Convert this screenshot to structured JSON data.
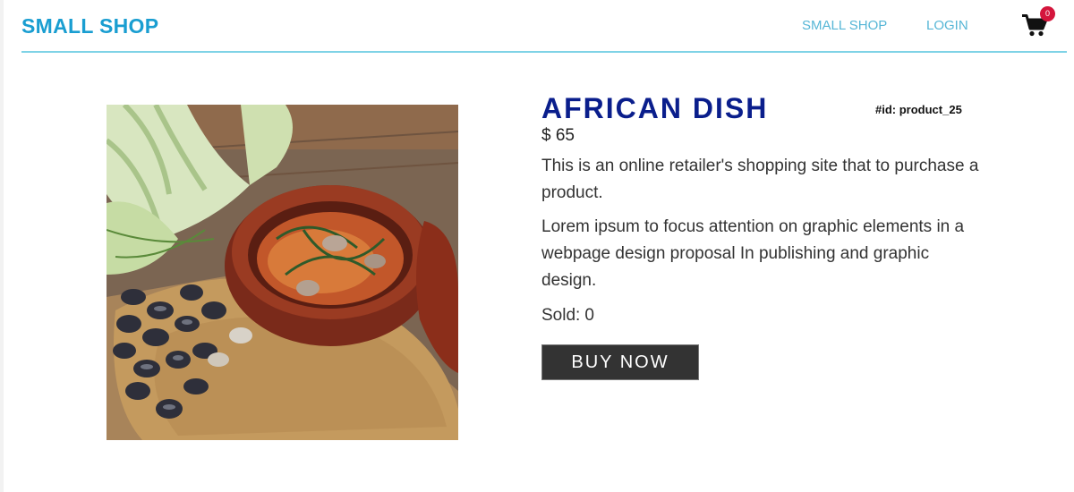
{
  "header": {
    "brand": "SMALL SHOP",
    "nav": [
      {
        "label": "SMALL SHOP"
      },
      {
        "label": "LOGIN"
      }
    ],
    "cart_icon": "shopping-cart-icon",
    "cart_count": "0"
  },
  "product": {
    "image_icon": "food-photo",
    "title": "AFRICAN DISH",
    "id_label": "#id: product_25",
    "price": "$ 65",
    "description_1": "This is an online retailer's shopping site that to purchase a product.",
    "description_2": "Lorem ipsum to focus attention on graphic elements in a webpage design proposal In publishing and graphic design.",
    "sold_label": "Sold:",
    "sold_count": "0",
    "buy_label": "BUY NOW"
  },
  "colors": {
    "brand": "#1a9ed1",
    "nav_link": "#56b6d6",
    "nav_border": "#7fd3e6",
    "title": "#0a1e8c",
    "badge": "#d4163c",
    "buy_button": "#333333"
  }
}
